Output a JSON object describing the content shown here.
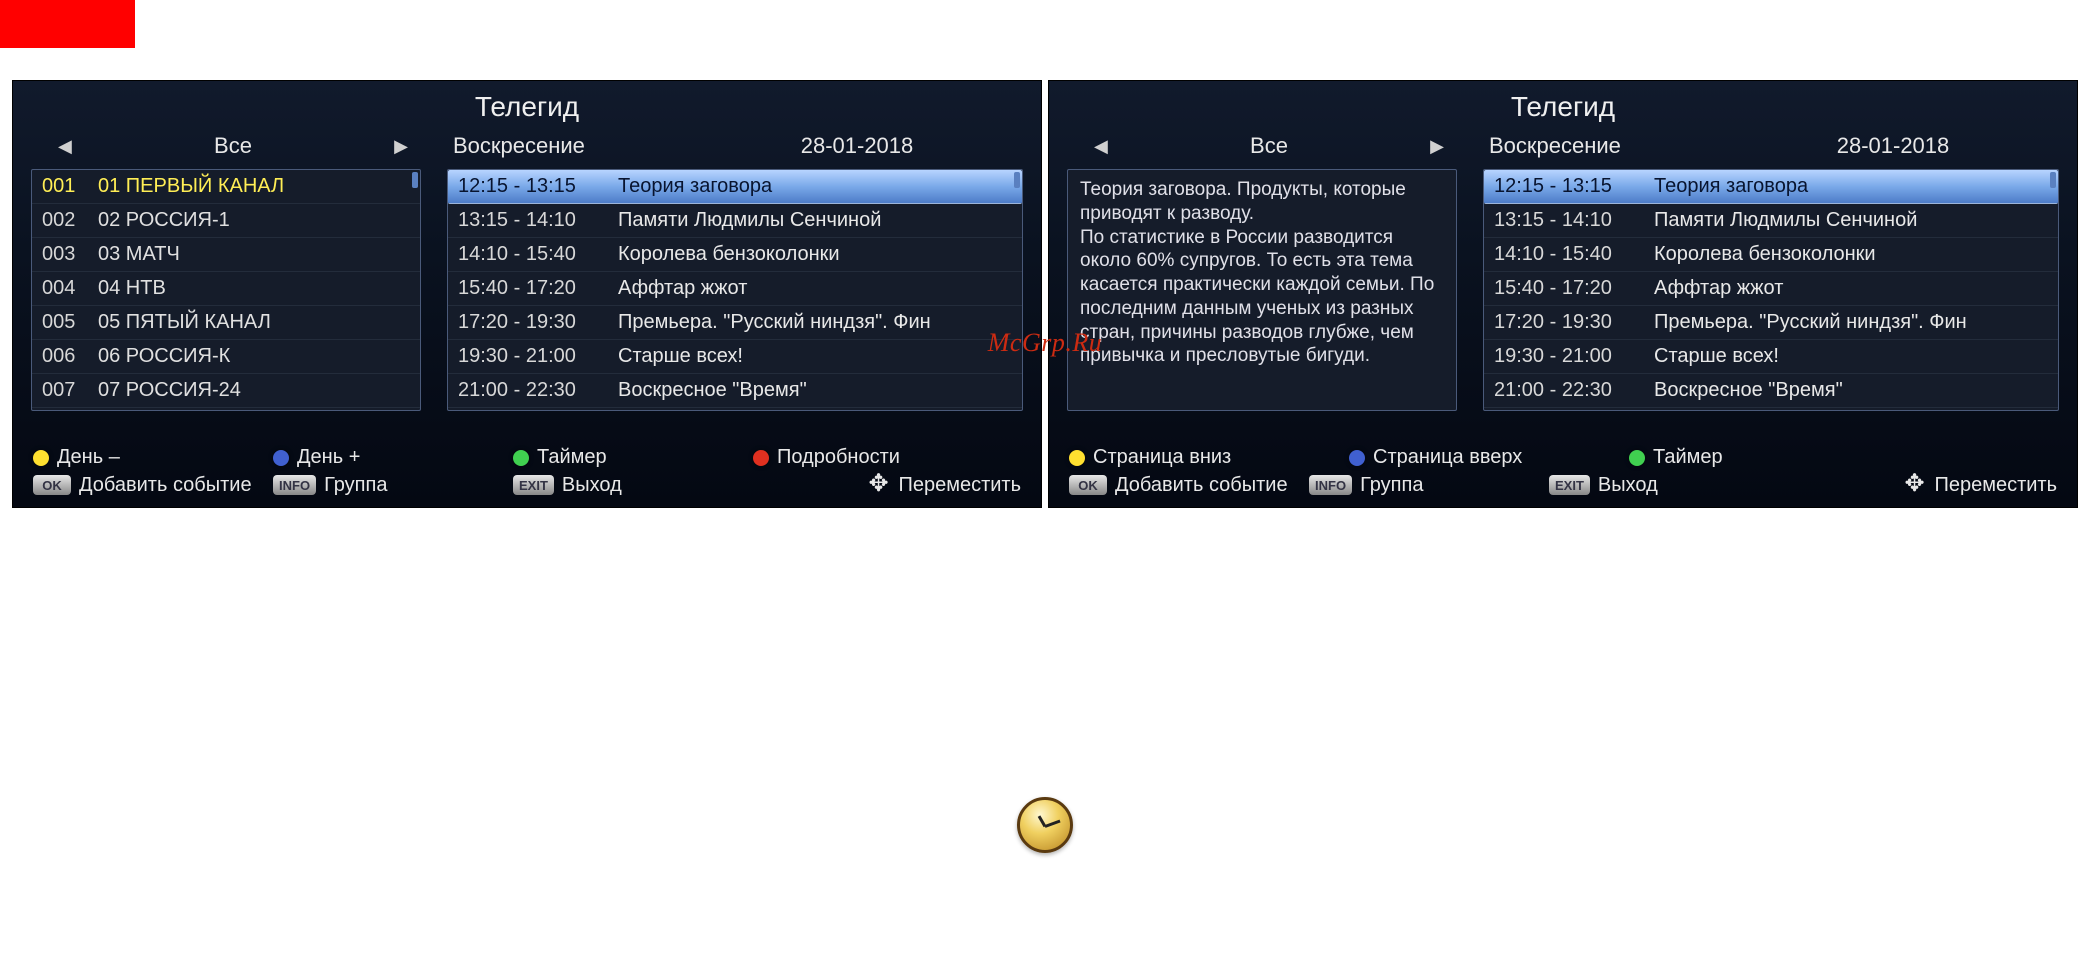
{
  "title": "Телегид",
  "filter": {
    "label": "Все"
  },
  "day_label": "Воскресение",
  "date": "28-01-2018",
  "watermark": "McGrp.Ru",
  "channels": [
    {
      "num": "001",
      "name": "01 ПЕРВЫЙ КАНАЛ",
      "selected": true
    },
    {
      "num": "002",
      "name": "02 РОССИЯ-1"
    },
    {
      "num": "003",
      "name": "03 МАТЧ"
    },
    {
      "num": "004",
      "name": "04 НТВ"
    },
    {
      "num": "005",
      "name": "05 ПЯТЫЙ КАНАЛ"
    },
    {
      "num": "006",
      "name": "06 РОССИЯ-К"
    },
    {
      "num": "007",
      "name": "07 РОССИЯ-24"
    }
  ],
  "programs": [
    {
      "time": "12:15 - 13:15",
      "title": "Теория заговора",
      "selected": true
    },
    {
      "time": "13:15 - 14:10",
      "title": "Памяти Людмилы Сенчиной"
    },
    {
      "time": "14:10 - 15:40",
      "title": "Королева бензоколонки"
    },
    {
      "time": "15:40 - 17:20",
      "title": "Аффтар жжот"
    },
    {
      "time": "17:20 - 19:30",
      "title": "Премьера. \"Русский ниндзя\". Фин"
    },
    {
      "time": "19:30 - 21:00",
      "title": "Старше всех!"
    },
    {
      "time": "21:00 - 22:30",
      "title": "Воскресное \"Время\""
    }
  ],
  "description": "Теория заговора. Продукты, которые приводят к разводу.\nПо статистике в России разводится около 60% супругов. То есть эта тема касается практически каждой семьи. По последним данным ученых из разных стран, причины разводов глубже, чем привычка и пресловутые бигуди.",
  "legend_left": {
    "yellow": "День –",
    "blue": "День +",
    "green": "Таймер",
    "red": "Подробности",
    "ok": "Добавить событие",
    "info": "Группа",
    "exit": "Выход",
    "move": "Переместить"
  },
  "legend_right": {
    "yellow": "Страница вниз",
    "blue": "Страница вверх",
    "green": "Таймер",
    "ok": "Добавить событие",
    "info": "Группа",
    "exit": "Выход",
    "move": "Переместить"
  },
  "btn": {
    "ok": "OK",
    "info": "INFO",
    "exit": "EXIT"
  }
}
